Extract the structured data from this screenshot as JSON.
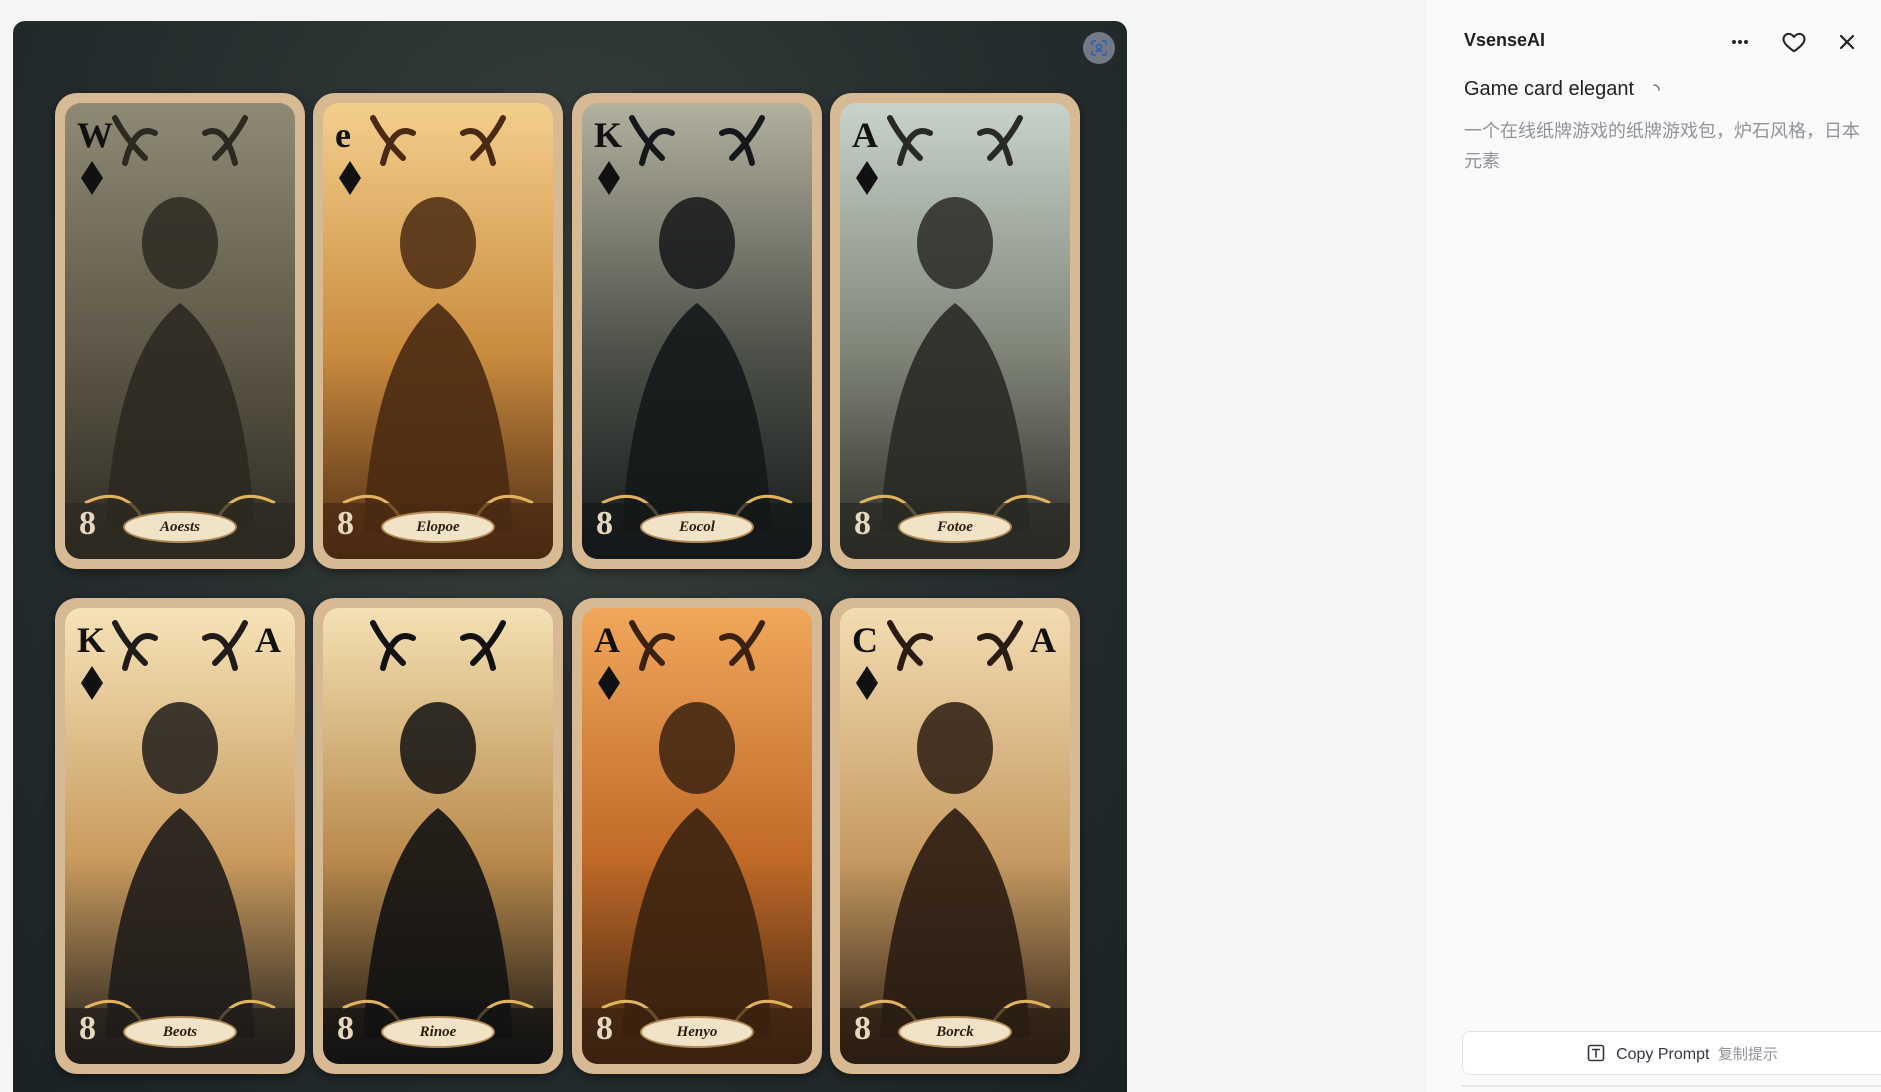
{
  "panel": {
    "brand": "VsenseAI",
    "title": "Game card elegant",
    "description": "一个在线纸牌游戏的纸牌游戏包，炉石风格，日本元素",
    "copy_button": {
      "label": "Copy Prompt",
      "label_cn": "复制提示"
    },
    "icons": {
      "more": "more-dots-icon",
      "favorite": "heart-icon",
      "close": "close-icon",
      "loading": "loading-spinner-icon",
      "copy": "copy-text-icon",
      "scan": "scan-icon"
    }
  },
  "cards": [
    {
      "rank_tl": "W",
      "rank_tr": "",
      "rank_bottom": "8",
      "banner": "Aoests",
      "palette": [
        "#8f8a76",
        "#5c5746",
        "#2c2921"
      ]
    },
    {
      "rank_tl": "e",
      "rank_tr": "",
      "rank_bottom": "8",
      "banner": "Elopoe",
      "palette": [
        "#f3cf8c",
        "#c98b3f",
        "#4a2a12"
      ]
    },
    {
      "rank_tl": "K",
      "rank_tr": "",
      "rank_bottom": "8",
      "banner": "Eocol",
      "palette": [
        "#b3b09e",
        "#4c5048",
        "#15181a"
      ]
    },
    {
      "rank_tl": "A",
      "rank_tr": "",
      "rank_bottom": "8",
      "banner": "Fotoe",
      "palette": [
        "#c8d3cb",
        "#7f8477",
        "#2a2a25"
      ]
    },
    {
      "rank_tl": "K",
      "rank_tr": "A",
      "rank_bottom": "8",
      "banner": "Beots",
      "palette": [
        "#f6e3b8",
        "#c99b5e",
        "#1f1c1a"
      ]
    },
    {
      "rank_tl": "",
      "rank_tr": "",
      "rank_bottom": "8",
      "banner": "Rinoe",
      "palette": [
        "#f4e1b4",
        "#b98a4c",
        "#121212"
      ]
    },
    {
      "rank_tl": "A",
      "rank_tr": "",
      "rank_bottom": "8",
      "banner": "Henyo",
      "palette": [
        "#f0a75b",
        "#c06a28",
        "#3b2210"
      ]
    },
    {
      "rank_tl": "C",
      "rank_tr": "A",
      "rank_bottom": "8",
      "banner": "Borck",
      "palette": [
        "#f3dcb2",
        "#c69a62",
        "#2a1c12"
      ]
    }
  ]
}
